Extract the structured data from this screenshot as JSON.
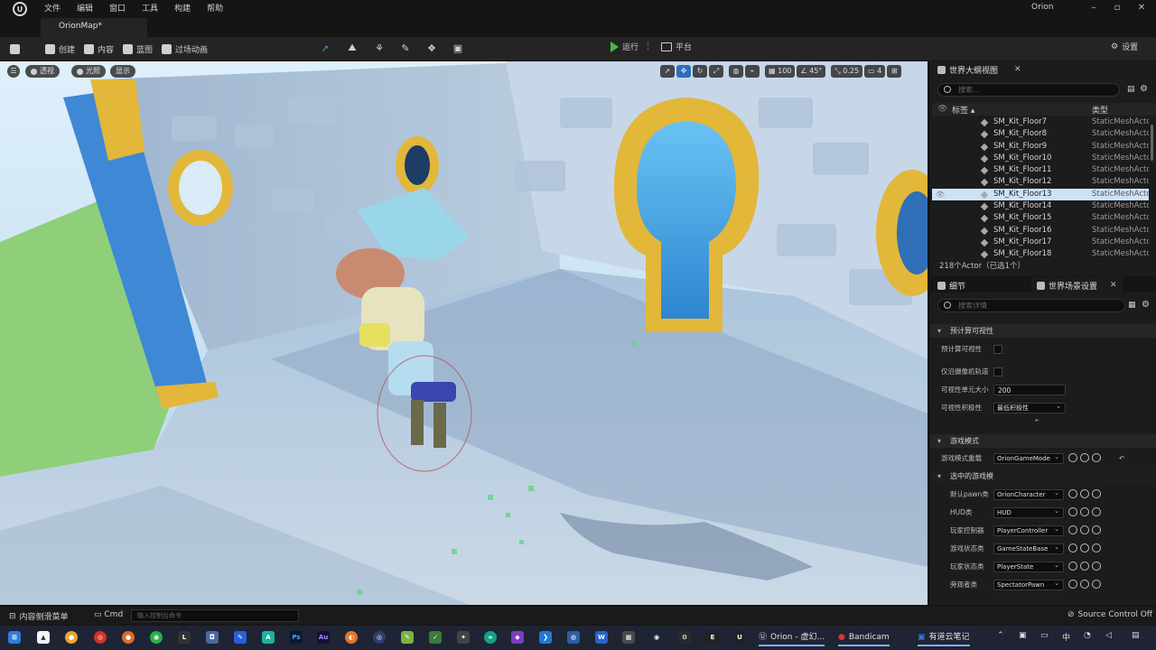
{
  "menubar": {
    "items": [
      "文件",
      "编辑",
      "窗口",
      "工具",
      "构建",
      "帮助"
    ],
    "project": "Orion"
  },
  "tab": {
    "label": "OrionMap*"
  },
  "toolbar": {
    "save_icon": "save-icon",
    "create": "创建",
    "content": "内容",
    "blueprint": "蓝图",
    "cinematics": "过场动画",
    "play": "运行",
    "more": "⋮",
    "platform": "平台",
    "settings": "设置"
  },
  "viewport": {
    "perspective": "透视",
    "lighting": "光照",
    "show": "显示",
    "grid_snap": "100",
    "rotation_snap": "45°",
    "scale_snap": "0.25",
    "camera_speed": "4"
  },
  "outliner": {
    "title": "世界大纲视图",
    "search_placeholder": "搜索...",
    "col_label": "标签",
    "col_type": "类型",
    "rows": [
      {
        "name": "SM_Kit_Floor7",
        "type": "StaticMeshActor"
      },
      {
        "name": "SM_Kit_Floor8",
        "type": "StaticMeshActor"
      },
      {
        "name": "SM_Kit_Floor9",
        "type": "StaticMeshActor"
      },
      {
        "name": "SM_Kit_Floor10",
        "type": "StaticMeshActor"
      },
      {
        "name": "SM_Kit_Floor11",
        "type": "StaticMeshActor"
      },
      {
        "name": "SM_Kit_Floor12",
        "type": "StaticMeshActor"
      },
      {
        "name": "SM_Kit_Floor13",
        "type": "StaticMeshActor"
      },
      {
        "name": "SM_Kit_Floor14",
        "type": "StaticMeshActor"
      },
      {
        "name": "SM_Kit_Floor15",
        "type": "StaticMeshActor"
      },
      {
        "name": "SM_Kit_Floor16",
        "type": "StaticMeshActor"
      },
      {
        "name": "SM_Kit_Floor17",
        "type": "StaticMeshActor"
      },
      {
        "name": "SM_Kit_Floor18",
        "type": "StaticMeshActor"
      }
    ],
    "selected_index": 6,
    "actor_count": "218个Actor（已选1个）"
  },
  "details": {
    "tab_details": "细节",
    "tab_world_settings": "世界场景设置",
    "search_placeholder": "搜索详情",
    "sections": {
      "precomputed_visibility": "预计算可视性",
      "game_mode": "游戏模式",
      "selected_game_mode": "选中的游戏模"
    },
    "props": {
      "precomputed_visibility": "预计算可视性",
      "camera_tracks_only": "仅沿摄像机轨道",
      "cell_size_label": "可视性单元大小",
      "cell_size_value": "200",
      "aggressiveness_label": "可视性积极性",
      "aggressiveness_value": "最低积极性",
      "gamemode_override_label": "游戏模式重载",
      "gamemode_override_value": "OrionGameMode",
      "pawn_label": "默认pawn类",
      "pawn_value": "OrionCharacter",
      "hud_label": "HUD类",
      "hud_value": "HUD",
      "pc_label": "玩家控制器",
      "pc_value": "PlayerController",
      "gs_label": "游戏状态类",
      "gs_value": "GameStateBase",
      "ps_label": "玩家状态类",
      "ps_value": "PlayerState",
      "spectator_label": "旁观者类",
      "spectator_value": "SpectatorPawn"
    }
  },
  "statusbar": {
    "content_drawer": "内容侧滑菜单",
    "cmd": "Cmd",
    "console_placeholder": "输入控制台命令",
    "source_control": "Source Control Off"
  },
  "taskbar": {
    "apps": [
      "Orion - 虚幻...",
      "Bandicam",
      "有道云笔记"
    ]
  }
}
